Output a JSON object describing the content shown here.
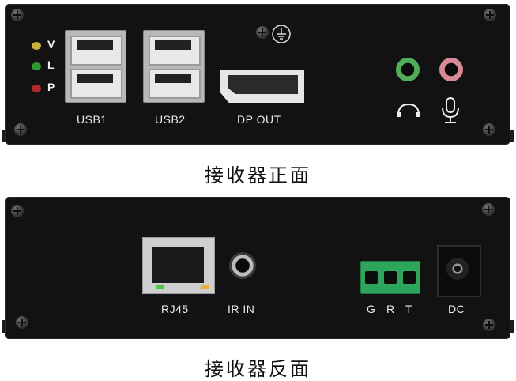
{
  "front_panel": {
    "leds": [
      {
        "label": "V",
        "color": "#c9b23a"
      },
      {
        "label": "L",
        "color": "#2f9a2f"
      },
      {
        "label": "P",
        "color": "#b02a2a"
      }
    ],
    "ports": {
      "usb1": "USB1",
      "usb2": "USB2",
      "dp": "DP OUT"
    },
    "icons": [
      "screw-icon",
      "ground-icon",
      "headphone-icon",
      "microphone-icon"
    ],
    "audio_jack_colors": {
      "headphone": "#4fae57",
      "mic": "#d98a96"
    },
    "caption": "接收器正面"
  },
  "rear_panel": {
    "ports": {
      "rj45": "RJ45",
      "ir": "IR IN",
      "terminal": [
        "G",
        "R",
        "T"
      ],
      "dc": "DC"
    },
    "terminal_color": "#2ea55c",
    "caption": "接收器反面"
  }
}
